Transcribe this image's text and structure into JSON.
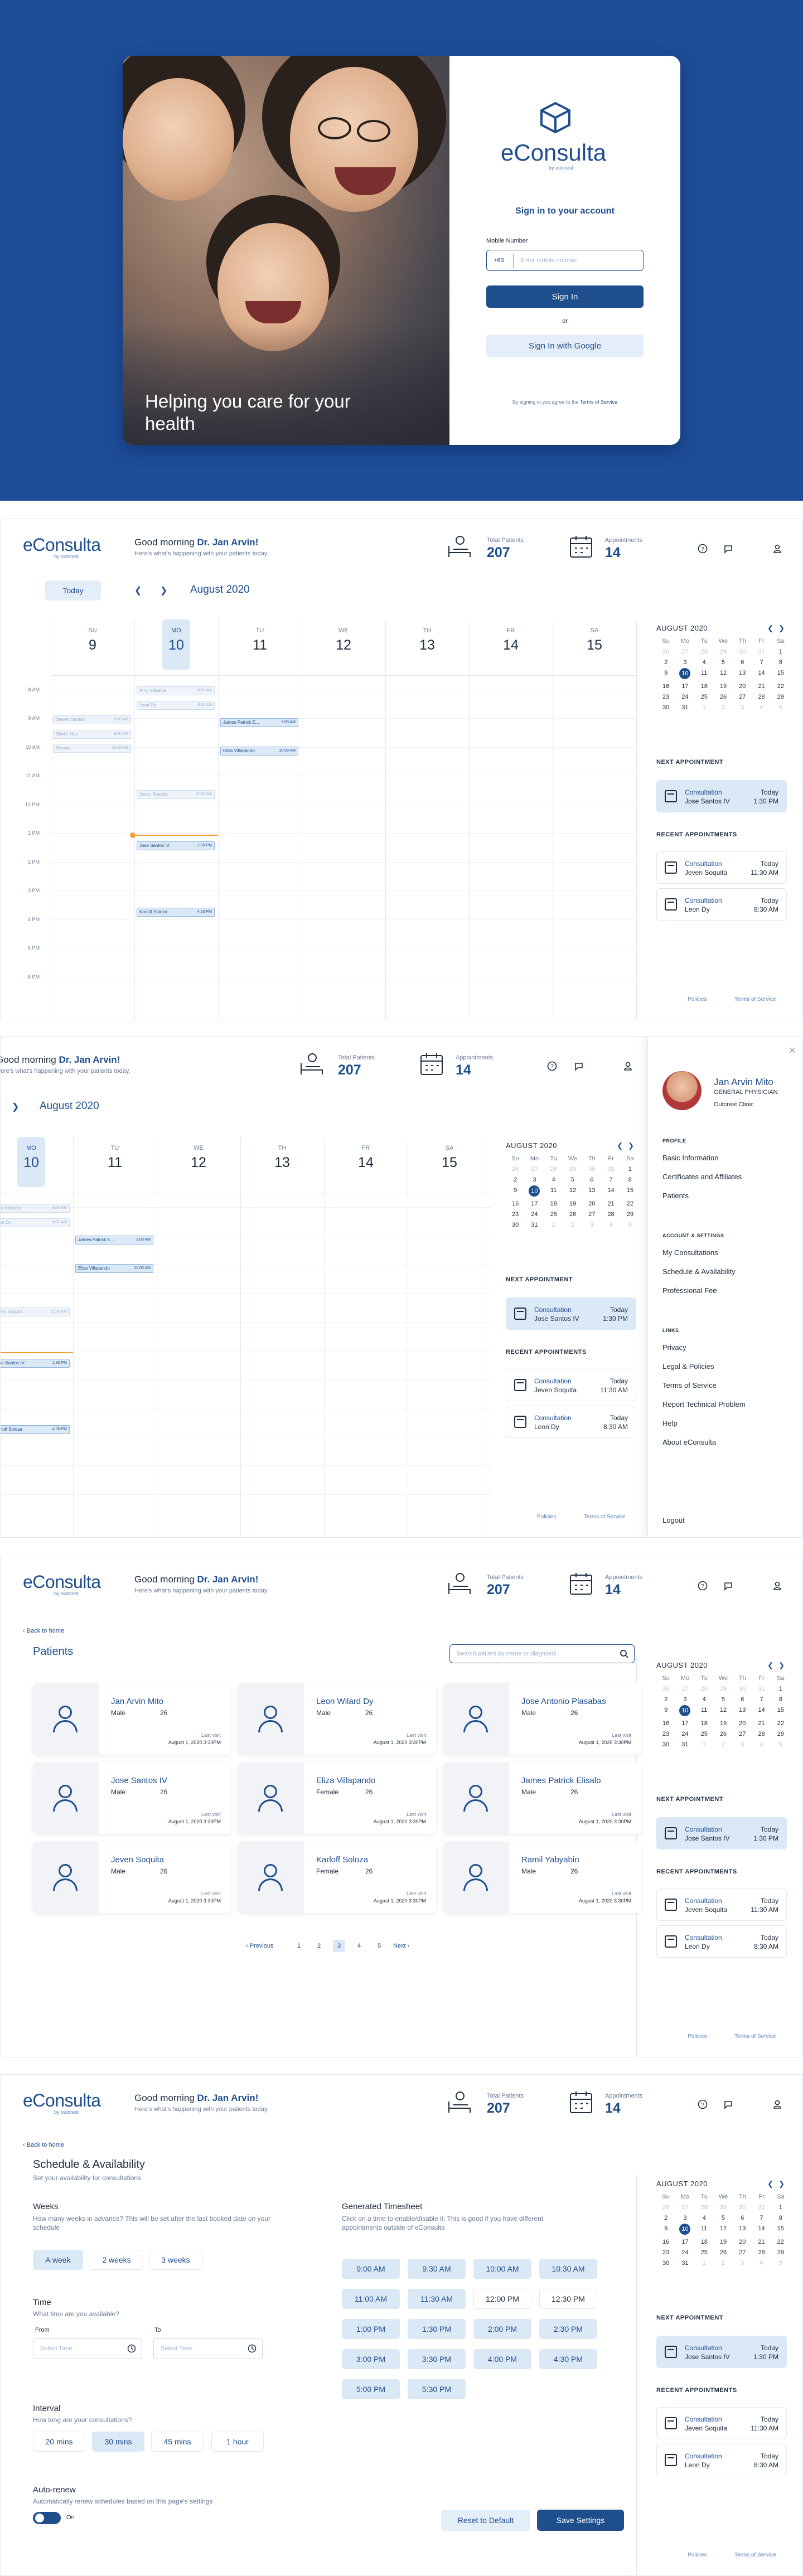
{
  "brand": {
    "name_a": "eCons",
    "name_u": "u",
    "name_b": "lta",
    "tagline": "by outcrest"
  },
  "login": {
    "headline": "Helping you care for your health",
    "title": "Sign in to your account",
    "mobile_label": "Mobile Number",
    "country_code": "+63",
    "mobile_placeholder": "Enter mobile number",
    "signin": "Sign In",
    "or": "or",
    "google": "Sign In with Google",
    "terms_prefix": "By signing in you agree to the",
    "terms_link": "Terms of Service"
  },
  "header": {
    "greeting": "Good morning ",
    "doctor": "Dr. Jan Arvin!",
    "subtext": "Here's what's happening with your patients today.",
    "total_patients_label": "Total Patients",
    "total_patients": "207",
    "appointments_label": "Appointments",
    "appointments": "14"
  },
  "calendar": {
    "today": "Today",
    "month": "August 2020",
    "days": [
      {
        "n": "SU",
        "d": "9"
      },
      {
        "n": "MO",
        "d": "10"
      },
      {
        "n": "TU",
        "d": "11"
      },
      {
        "n": "WE",
        "d": "12"
      },
      {
        "n": "TH",
        "d": "13"
      },
      {
        "n": "FR",
        "d": "14"
      },
      {
        "n": "SA",
        "d": "15"
      }
    ],
    "times": [
      "8 AM",
      "9 AM",
      "10 AM",
      "11 AM",
      "12 PM",
      "1 PM",
      "2 PM",
      "3 PM",
      "4 PM",
      "5 PM",
      "6 PM"
    ],
    "events": [
      {
        "col": 1,
        "row": 0.2,
        "t": "Amy Villaalba",
        "tm": "8:00 AM",
        "faded": true
      },
      {
        "col": 1,
        "row": 0.7,
        "t": "Leon Dy",
        "tm": "8:30 AM",
        "faded": true
      },
      {
        "col": 0,
        "row": 1.2,
        "t": "Steven Santos",
        "tm": "9:00 AM",
        "faded": true
      },
      {
        "col": 0,
        "row": 1.7,
        "t": "Shella May",
        "tm": "9:30 AM",
        "faded": true
      },
      {
        "col": 0,
        "row": 2.2,
        "t": "Dessay",
        "tm": "10:00 AM",
        "faded": true
      },
      {
        "col": 2,
        "row": 1.3,
        "t": "James Patrick E...",
        "tm": "9:00 AM",
        "faded": false
      },
      {
        "col": 2,
        "row": 2.3,
        "t": "Eliza Villapando",
        "tm": "10:00 AM",
        "faded": false
      },
      {
        "col": 1,
        "row": 3.8,
        "t": "Jeven Soquita",
        "tm": "11:30 AM",
        "faded": true
      },
      {
        "col": 1,
        "row": 5.6,
        "t": "Jose Santos IV",
        "tm": "1:30 PM",
        "faded": false
      },
      {
        "col": 1,
        "row": 7.9,
        "t": "Karloff Soloza",
        "tm": "4:00 PM",
        "faded": false
      }
    ],
    "mini_title": "AUGUST 2020",
    "mini_heads": [
      "Su",
      "Mo",
      "Tu",
      "We",
      "Th",
      "Fr",
      "Sa"
    ],
    "mini_days": [
      [
        "26",
        "27",
        "28",
        "29",
        "30",
        "31",
        "1"
      ],
      [
        "2",
        "3",
        "4",
        "5",
        "6",
        "7",
        "8"
      ],
      [
        "9",
        "10",
        "11",
        "12",
        "13",
        "14",
        "15"
      ],
      [
        "16",
        "17",
        "18",
        "19",
        "20",
        "21",
        "22"
      ],
      [
        "23",
        "24",
        "25",
        "26",
        "27",
        "28",
        "29"
      ],
      [
        "30",
        "31",
        "1",
        "2",
        "3",
        "4",
        "5"
      ]
    ]
  },
  "sidebar": {
    "next_label": "NEXT APPOINTMENT",
    "next": {
      "type": "Consultation",
      "name": "Jose Santos IV",
      "day": "Today",
      "time": "1:30 PM"
    },
    "recent_label": "RECENT APPOINTMENTS",
    "recent": [
      {
        "type": "Consultation",
        "name": "Jeven Soquita",
        "day": "Today",
        "time": "11:30 AM"
      },
      {
        "type": "Consultation",
        "name": "Leon Dy",
        "day": "Today",
        "time": "8:30 AM"
      }
    ],
    "policies": "Policies",
    "terms": "Terms of Service"
  },
  "profile": {
    "name": "Jan Arvin Mito",
    "role": "GENERAL PHYSICIAN",
    "clinic": "Outcrest Clinic",
    "profile_label": "PROFILE",
    "profile_items": [
      "Basic Information",
      "Certificates and Affiliates",
      "Patients"
    ],
    "account_label": "ACCOUNT & SETTINGS",
    "account_items": [
      "My Consultations",
      "Schedule & Availability",
      "Professional Fee"
    ],
    "links_label": "LINKS",
    "links_items": [
      "Privacy",
      "Legal & Policies",
      "Terms of Service",
      "Report Technical Problem",
      "Help",
      "About eConsulta"
    ],
    "logout": "Logout"
  },
  "patients": {
    "back": "Back to home",
    "title": "Patients",
    "search_placeholder": "Search patient by name or diagnosis",
    "last_visit_label": "Last visit",
    "list": [
      {
        "name": "Jan Arvin Mito",
        "gender": "Male",
        "age": "26",
        "last": "August 1, 2020 3:30PM"
      },
      {
        "name": "Leon Wilard Dy",
        "gender": "Male",
        "age": "26",
        "last": "August 1, 2020 3:30PM"
      },
      {
        "name": "Jose Antonio Plasabas",
        "gender": "Male",
        "age": "26",
        "last": "August 1, 2020 3:30PM"
      },
      {
        "name": "Jose Santos IV",
        "gender": "Male",
        "age": "26",
        "last": "August 1, 2020 3:30PM"
      },
      {
        "name": "Eliza Villapando",
        "gender": "Female",
        "age": "26",
        "last": "August 1, 2020 3:30PM"
      },
      {
        "name": "James Patrick Elisalo",
        "gender": "Male",
        "age": "26",
        "last": "August 1, 2020 3:30PM"
      },
      {
        "name": "Jeven Soquita",
        "gender": "Male",
        "age": "26",
        "last": "August 1, 2020 3:30PM"
      },
      {
        "name": "Karloff Soloza",
        "gender": "Female",
        "age": "26",
        "last": "August 1, 2020 3:30PM"
      },
      {
        "name": "Ramil Yabyabin",
        "gender": "Male",
        "age": "26",
        "last": "August 1, 2020 3:30PM"
      }
    ],
    "prev": "Previous",
    "next": "Next",
    "pages": [
      "1",
      "2",
      "3",
      "4",
      "5"
    ],
    "current_page": "3"
  },
  "schedule": {
    "back": "Back to home",
    "title": "Schedule & Availability",
    "subtitle": "Set your availability for consultations",
    "weeks_label": "Weeks",
    "weeks_help": "How many weeks in advance? This will be set after the last booked date on your schedule",
    "weeks_opts": [
      "A week",
      "2 weeks",
      "3 weeks"
    ],
    "time_label": "Time",
    "time_help": "What time are you available?",
    "from": "From",
    "to": "To",
    "time_placeholder": "Select Time",
    "interval_label": "Interval",
    "interval_help": "How long are your consultations?",
    "interval_opts": [
      "20 mins",
      "30 mins",
      "45 mins",
      "1 hour"
    ],
    "autorenew_label": "Auto-renew",
    "autorenew_help": "Automatically renew schedules based on this page's settings",
    "autorenew_state": "On",
    "ts_label": "Generated Timesheet",
    "ts_help": "Click on a time to enable/disable it. This is good if you have different appointments outside of eConsulta",
    "slots": [
      "9:00 AM",
      "9:30 AM",
      "10:00 AM",
      "10:30 AM",
      "11:00 AM",
      "11:30 AM",
      "12:00 PM",
      "12:30 PM",
      "1:00 PM",
      "1:30 PM",
      "2:00 PM",
      "2:30 PM",
      "3:00 PM",
      "3:30 PM",
      "4:00 PM",
      "4:30 PM",
      "5:00 PM",
      "5:30 PM"
    ],
    "slots_off": [
      "12:00 PM",
      "12:30 PM"
    ],
    "reset": "Reset to Default",
    "save": "Save Settings"
  },
  "colors": {
    "primary": "#1f4e8c",
    "hero": "#1d4c98",
    "highlight": "#dbe8f6",
    "current_time": "#f0a030"
  }
}
